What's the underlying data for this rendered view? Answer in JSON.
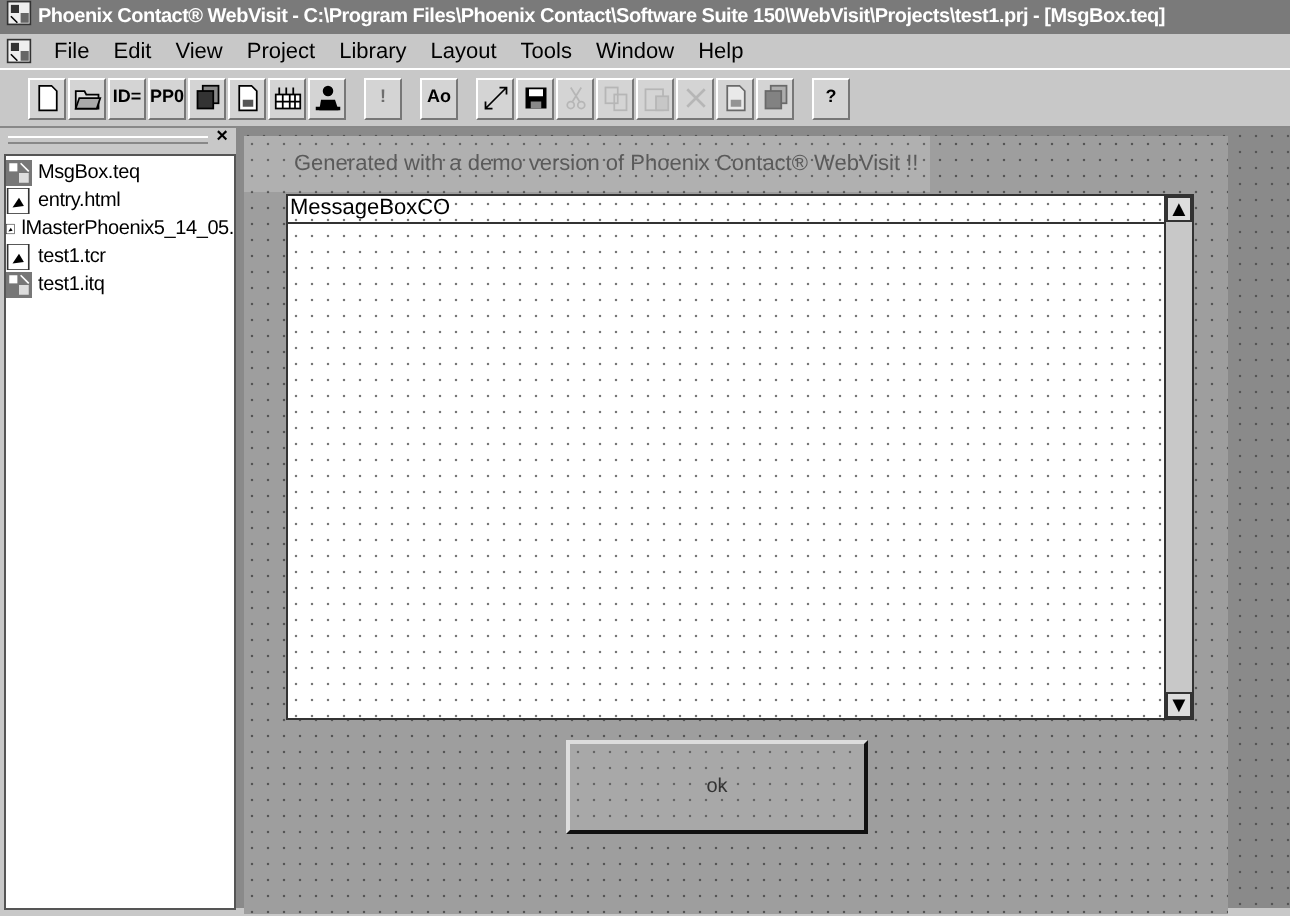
{
  "window": {
    "title": "Phoenix Contact® WebVisit - C:\\Program Files\\Phoenix Contact\\Software Suite 150\\WebVisit\\Projects\\test1.prj - [MsgBox.teq]"
  },
  "menu": [
    "File",
    "Edit",
    "View",
    "Project",
    "Library",
    "Layout",
    "Tools",
    "Window",
    "Help"
  ],
  "toolbar": [
    {
      "kind": "new",
      "disabled": false
    },
    {
      "kind": "open",
      "disabled": false
    },
    {
      "kind": "text",
      "label": "ID=",
      "disabled": false
    },
    {
      "kind": "text",
      "label": "PP0",
      "disabled": false
    },
    {
      "kind": "stack",
      "disabled": false
    },
    {
      "kind": "page",
      "disabled": false
    },
    {
      "kind": "grid",
      "disabled": false
    },
    {
      "kind": "figure",
      "disabled": false
    },
    {
      "kind": "sep"
    },
    {
      "kind": "text",
      "label": "!",
      "disabled": true
    },
    {
      "kind": "sep"
    },
    {
      "kind": "text",
      "label": "Ao",
      "disabled": false
    },
    {
      "kind": "sep"
    },
    {
      "kind": "arrows",
      "disabled": false
    },
    {
      "kind": "save",
      "disabled": false
    },
    {
      "kind": "cut",
      "disabled": true
    },
    {
      "kind": "copy",
      "disabled": true
    },
    {
      "kind": "paste",
      "disabled": true
    },
    {
      "kind": "delete",
      "disabled": true
    },
    {
      "kind": "page",
      "disabled": true
    },
    {
      "kind": "stack",
      "disabled": true
    },
    {
      "kind": "sep"
    },
    {
      "kind": "text",
      "label": "?",
      "disabled": false
    }
  ],
  "panel": {
    "close": "×",
    "files": [
      {
        "name": "MsgBox.teq",
        "kind": "teq"
      },
      {
        "name": "entry.html",
        "kind": "html"
      },
      {
        "name": "lMasterPhoenix5_14_05.",
        "kind": "html"
      },
      {
        "name": "test1.tcr",
        "kind": "html"
      },
      {
        "name": "test1.itq",
        "kind": "teq"
      }
    ]
  },
  "canvas": {
    "banner": "Generated with a demo version of Phoenix Contact® WebVisit !!",
    "message_box": {
      "label": "MessageBoxCO",
      "up": "▲",
      "down": "▼"
    },
    "button": "ok"
  }
}
